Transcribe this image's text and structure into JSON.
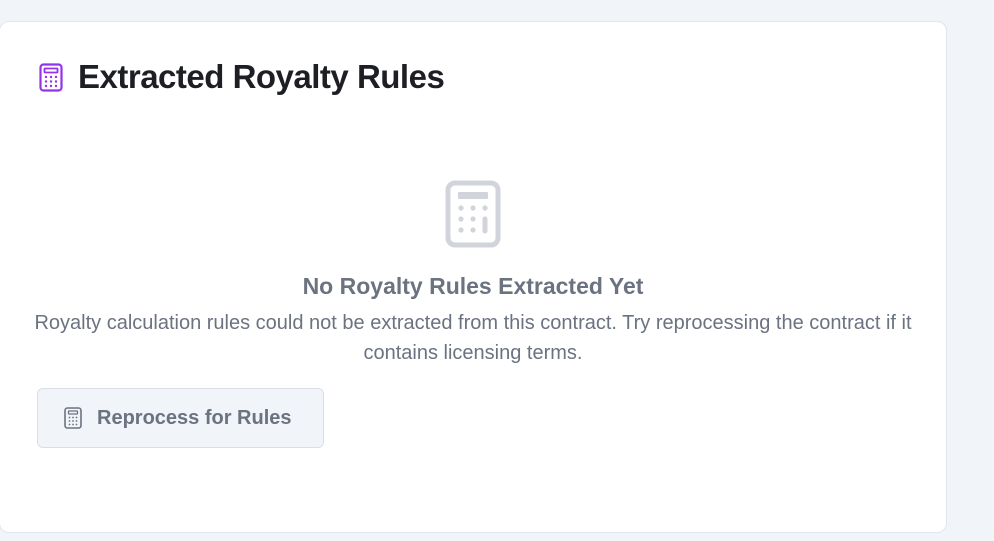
{
  "card": {
    "title": "Extracted Royalty Rules",
    "header_icon": "calculator-icon",
    "accent_color": "#9333ea"
  },
  "empty_state": {
    "icon": "calculator-icon",
    "title": "No Royalty Rules Extracted Yet",
    "description": "Royalty calculation rules could not be extracted from this contract. Try reprocessing the contract if it contains licensing terms."
  },
  "actions": {
    "reprocess_label": "Reprocess for Rules",
    "reprocess_icon": "calculator-icon"
  }
}
